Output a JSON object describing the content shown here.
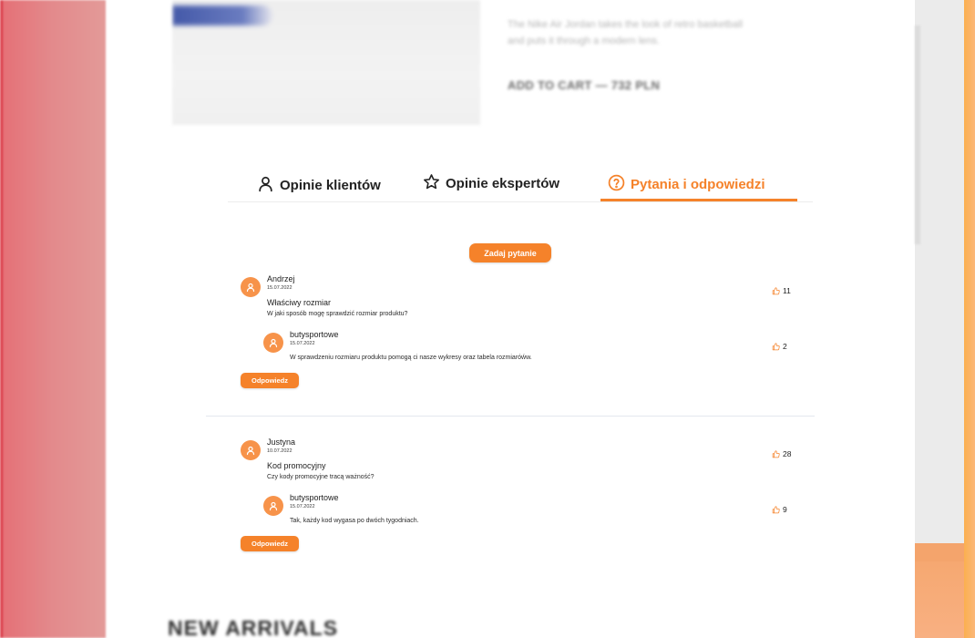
{
  "product": {
    "description": "The Nike Air Jordan takes the look of retro basketball and puts it through a modern lens.",
    "add_to_cart": "ADD TO CART — 732 PLN"
  },
  "tabs": [
    {
      "label": "Opinie klientów",
      "icon": "user-icon",
      "active": false
    },
    {
      "label": "Opinie ekspertów",
      "icon": "star-icon",
      "active": false
    },
    {
      "label": "Pytania i odpowiedzi",
      "icon": "question-circle-icon",
      "active": true
    }
  ],
  "ask_button": "Zadaj pytanie",
  "questions": [
    {
      "author": "Andrzej",
      "date": "15.07.2022",
      "title": "Właściwy rozmiar",
      "text": "W jaki sposób mogę sprawdzić rozmiar produktu?",
      "likes": "11",
      "answer": {
        "author": "butysportowe",
        "date": "15.07.2022",
        "text": "W sprawdzeniu rozmiaru produktu pomogą ci nasze wykresy oraz tabela rozmiaróẃw.",
        "likes": "2"
      },
      "reply_label": "Odpowiedz"
    },
    {
      "author": "Justyna",
      "date": "10.07.2022",
      "title": "Kod promocyjny",
      "text": "Czy kody promocyjne tracą ważność?",
      "likes": "28",
      "answer": {
        "author": "butysportowe",
        "date": "15.07.2022",
        "text": "Tak, każdy kod wygasa po dwóch tygodniach.",
        "likes": "9"
      },
      "reply_label": "Odpowiedz"
    }
  ],
  "section_heading": "NEW ARRIVALS",
  "colors": {
    "accent": "#f5822a",
    "avatar": "#f7934a",
    "text": "#1f1f1f"
  }
}
